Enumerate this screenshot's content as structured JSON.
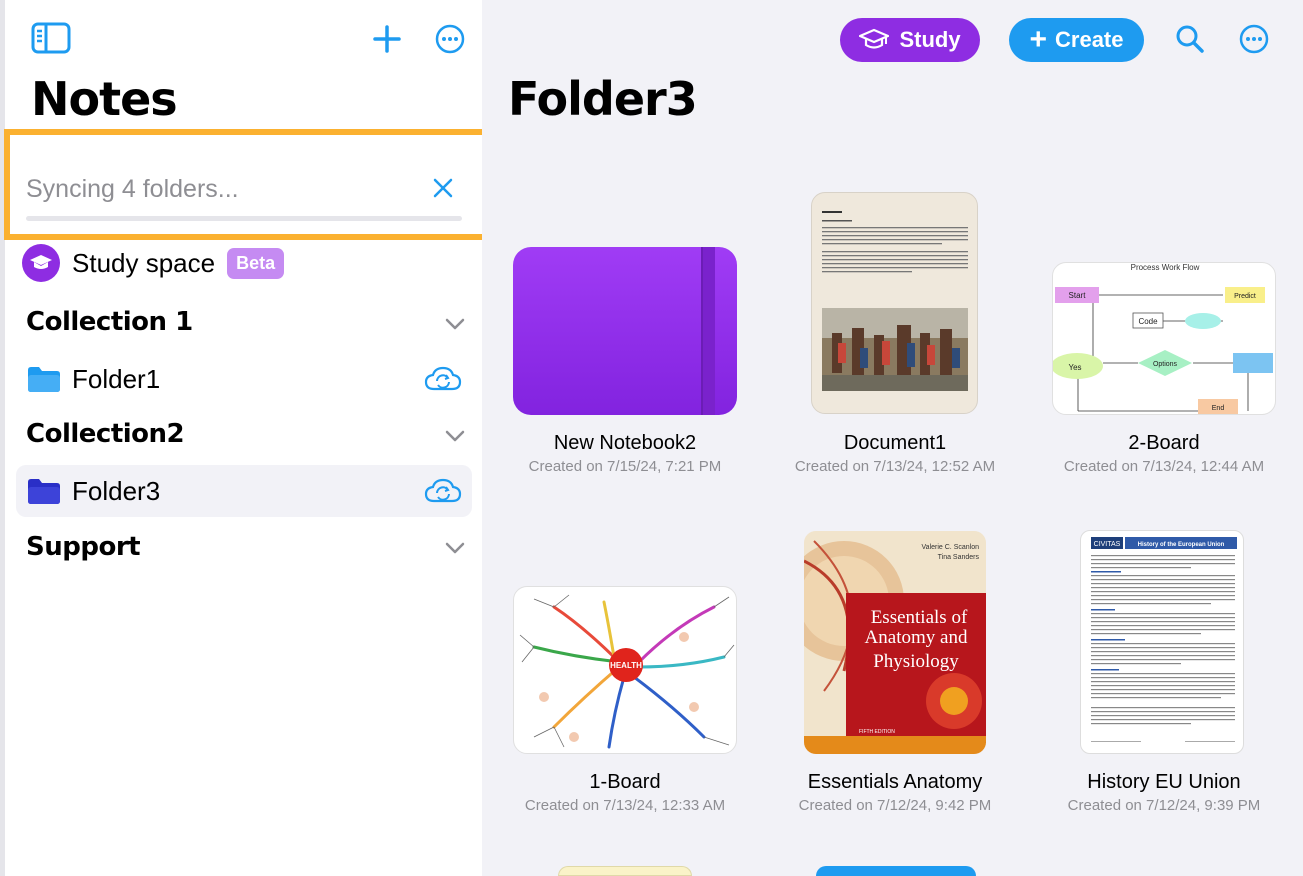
{
  "sidebar": {
    "title": "Notes",
    "sync": {
      "text": "Syncing 4 folders...",
      "progress": 0
    },
    "study_space": {
      "label": "Study space",
      "badge": "Beta"
    },
    "collections": [
      {
        "name": "Collection 1",
        "folders": [
          {
            "name": "Folder1",
            "selected": false
          }
        ]
      },
      {
        "name": "Collection2",
        "folders": [
          {
            "name": "Folder3",
            "selected": true
          }
        ]
      },
      {
        "name": "Support",
        "folders": []
      }
    ]
  },
  "toolbar": {
    "study_label": "Study",
    "create_label": "Create"
  },
  "main": {
    "title": "Folder3",
    "items": [
      {
        "name": "New Notebook2",
        "date": "Created on 7/15/24, 7:21 PM"
      },
      {
        "name": "Document1",
        "date": "Created on 7/13/24, 12:52 AM"
      },
      {
        "name": "2-Board",
        "date": "Created on 7/13/24, 12:44 AM"
      },
      {
        "name": "1-Board",
        "date": "Created on 7/13/24, 12:33 AM"
      },
      {
        "name": "Essentials Anatomy",
        "date": "Created on 7/12/24, 9:42 PM"
      },
      {
        "name": "History EU Union",
        "date": "Created on 7/12/24, 9:39 PM"
      }
    ],
    "thumb_text": {
      "board_title": "Process Work Flow",
      "board_labels": [
        "Start",
        "Predict",
        "Code",
        "Yes",
        "Options",
        "End"
      ],
      "book_authors": [
        "Valerie C. Scanlon",
        "Tina Sanders"
      ],
      "book_title": [
        "Essentials of",
        "Anatomy and",
        "Physiology"
      ],
      "book_edition": "FIFTH EDITION",
      "mindmap_center": "HEALTH",
      "eu_logo": "CIVITAS",
      "eu_header": "History of the European Union"
    }
  },
  "colors": {
    "accent_blue": "#1e9bf0",
    "study_purple": "#8e2de2",
    "sync_border": "#fbb130"
  }
}
